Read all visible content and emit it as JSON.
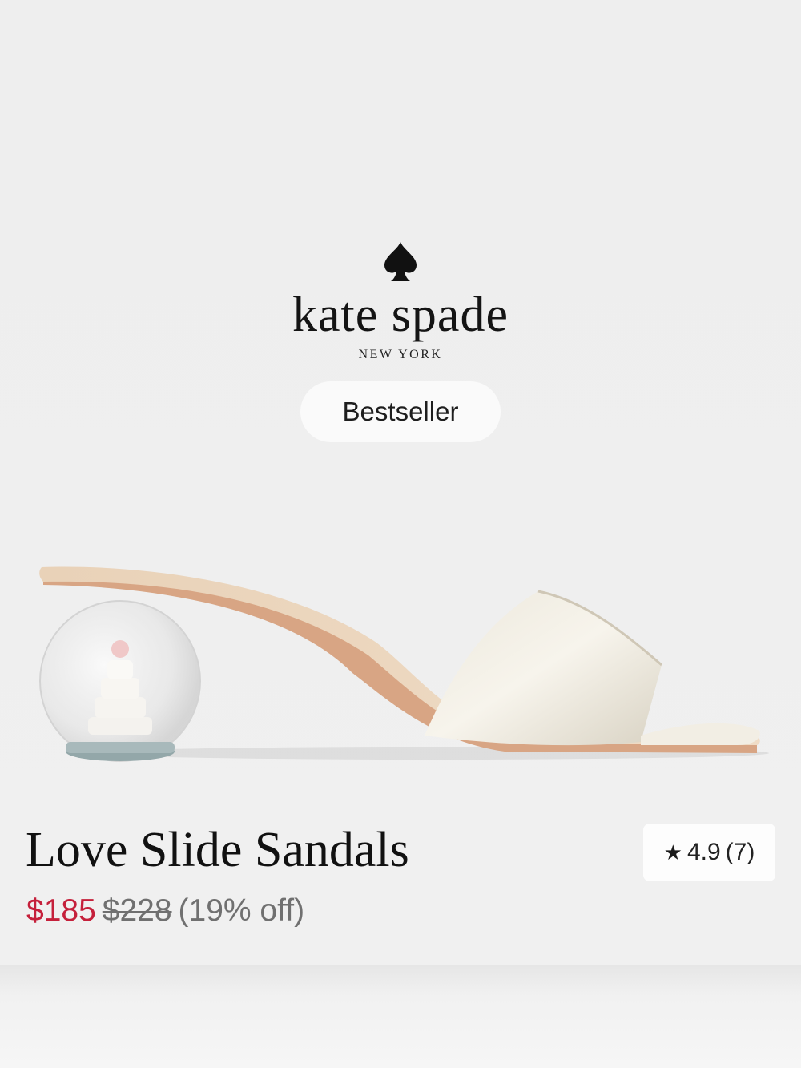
{
  "brand": {
    "logo_icon": "spade-icon",
    "name": "kate spade",
    "city": "NEW YORK"
  },
  "badge": {
    "label": "Bestseller"
  },
  "product": {
    "image": "slide-sandal-with-snowglobe-heel",
    "title": "Love Slide Sandals",
    "price": "$185",
    "original_price": "$228",
    "discount": "(19% off)",
    "rating": {
      "icon": "star-icon",
      "score": "4.9",
      "count": "(7)"
    }
  },
  "colors": {
    "sale_price": "#c5203b",
    "background": "#efefef",
    "text": "#111111"
  }
}
